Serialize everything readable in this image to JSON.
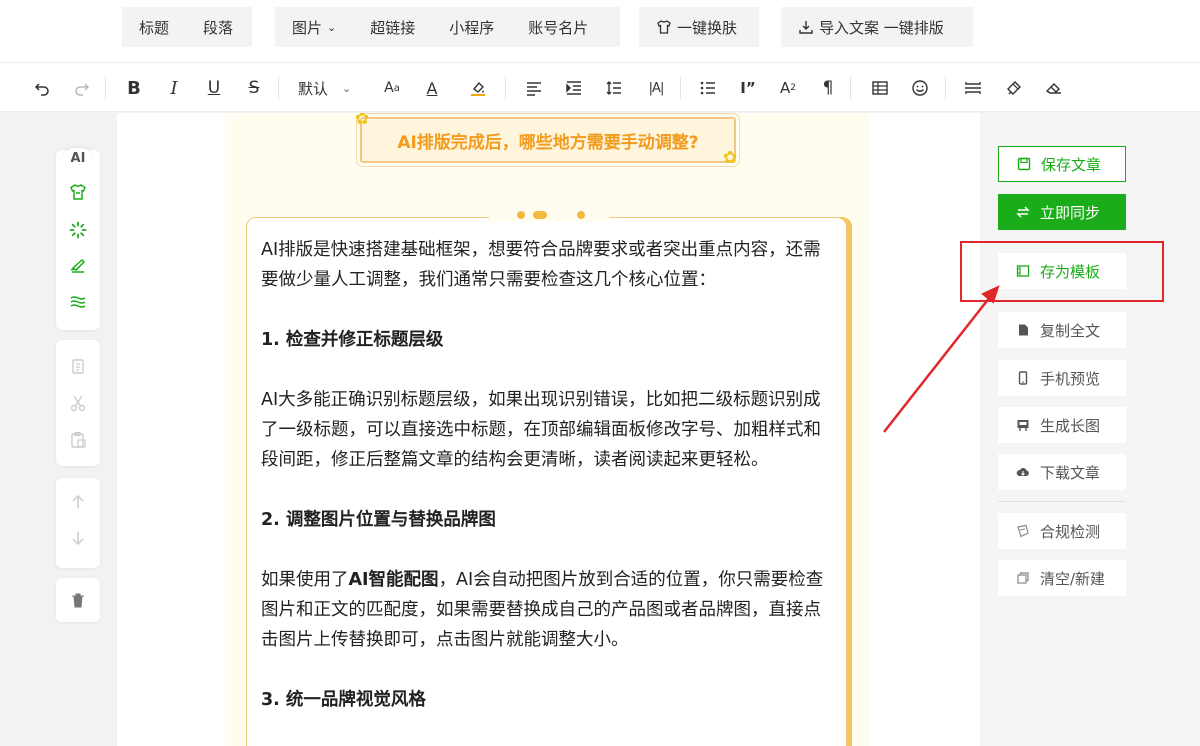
{
  "top_menu": {
    "group1": [
      "标题",
      "段落"
    ],
    "group2": [
      "图片",
      "超链接",
      "小程序",
      "账号名片"
    ],
    "skin": "一键换肤",
    "import": "导入文案 一键排版"
  },
  "toolbar": {
    "font_default": "默认"
  },
  "left_tools": {
    "ai_label": "AI"
  },
  "article": {
    "title": "AI排版完成后，哪些地方需要手动调整?",
    "intro": "AI排版是快速搭建基础框架，想要符合品牌要求或者突出重点内容，还需要做少量人工调整，我们通常只需要检查这几个核心位置：",
    "h1": "1. 检查并修正标题层级",
    "p1": "AI大多能正确识别标题层级，如果出现识别错误，比如把二级标题识别成了一级标题，可以直接选中标题，在顶部编辑面板修改字号、加粗样式和段间距，修正后整篇文章的结构会更清晰，读者阅读起来更轻松。",
    "h2": "2. 调整图片位置与替换品牌图",
    "p2_pre": "如果使用了",
    "p2_bold": "AI智能配图",
    "p2_post": "，AI会自动把图片放到合适的位置，你只需要检查图片和正文的匹配度，如果需要替换成自己的产品图或者品牌图，直接点击图片上传替换即可，点击图片就能调整大小。",
    "h3": "3. 统一品牌视觉风格"
  },
  "right_panel": {
    "save": "保存文章",
    "sync": "立即同步",
    "template": "存为模板",
    "copy": "复制全文",
    "preview": "手机预览",
    "long_image": "生成长图",
    "download": "下载文章",
    "compliance": "合规检测",
    "clear": "清空/新建"
  },
  "colors": {
    "brand_green": "#1aad19",
    "title_orange": "#f29b1d",
    "highlight_red": "#e0282c",
    "card_border": "#f2c77c"
  }
}
